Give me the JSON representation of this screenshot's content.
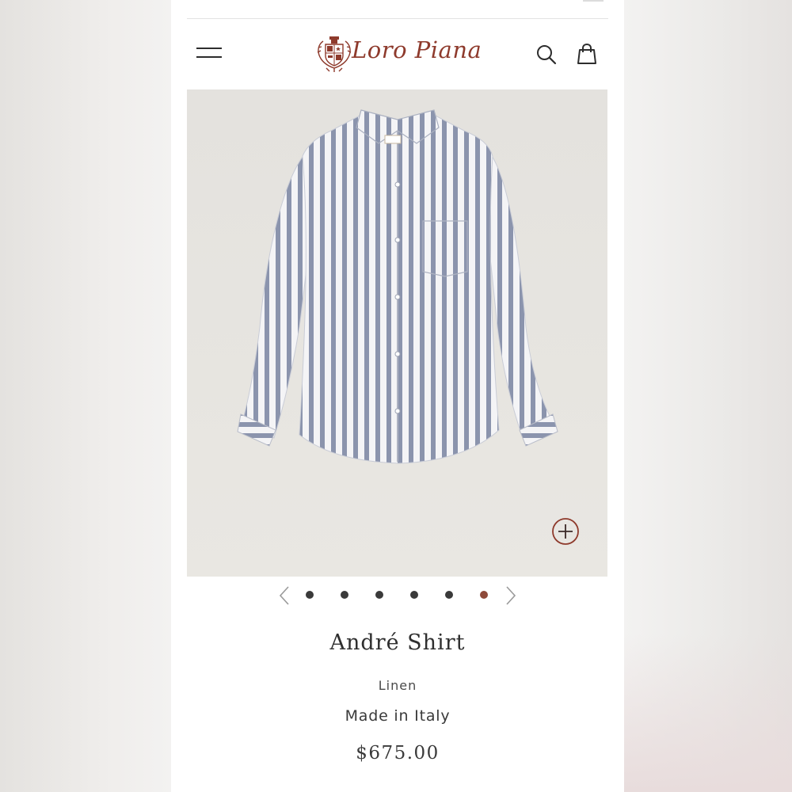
{
  "header": {
    "brand_name": "Loro Piana",
    "icons": {
      "menu": "hamburger-menu-icon",
      "search": "search-icon",
      "bag": "shopping-bag-icon",
      "crest": "crest-logo-icon"
    }
  },
  "gallery": {
    "image_alt": "striped linen shirt",
    "zoom_icon": "zoom-plus-icon",
    "total_images": 6,
    "active_index": 6,
    "prev_icon": "chevron-left-icon",
    "next_icon": "chevron-right-icon"
  },
  "product": {
    "name": "André Shirt",
    "material": "Linen",
    "origin": "Made in Italy",
    "price": "$675.00"
  },
  "colors": {
    "brand": "#8e3a2c",
    "active_dot": "#8e4a3a",
    "inactive_dot": "#3a3a3a",
    "image_background": "#e6e4df"
  }
}
